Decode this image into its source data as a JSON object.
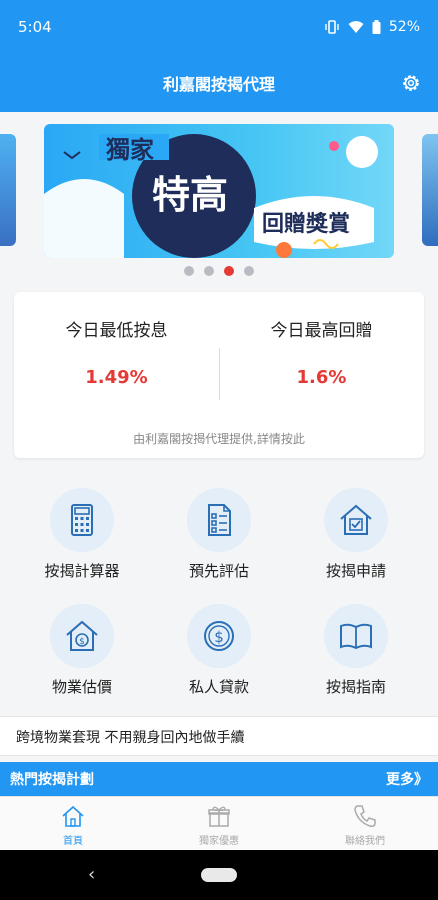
{
  "status": {
    "time": "5:04",
    "battery": "52%"
  },
  "appbar": {
    "title": "利嘉閣按揭代理"
  },
  "banner": {
    "line1": "獨家",
    "line2": "特高",
    "line3": "回贈獎賞"
  },
  "carousel": {
    "page_count": 4,
    "active_index": 2
  },
  "rates": {
    "lowest_label": "今日最低按息",
    "lowest_value": "1.49%",
    "highest_label": "今日最高回贈",
    "highest_value": "1.6%",
    "note": "由利嘉閣按揭代理提供,詳情按此"
  },
  "services": [
    {
      "label": "按揭計算器",
      "icon": "calculator-icon"
    },
    {
      "label": "預先評估",
      "icon": "checklist-icon"
    },
    {
      "label": "按揭申請",
      "icon": "house-check-icon"
    },
    {
      "label": "物業估價",
      "icon": "house-dollar-icon"
    },
    {
      "label": "私人貸款",
      "icon": "coin-dollar-icon"
    },
    {
      "label": "按揭指南",
      "icon": "book-icon"
    }
  ],
  "marquee": {
    "text": "跨境物業套現 不用親身回內地做手續"
  },
  "hot_plans": {
    "title": "熱門按揭計劃",
    "more": "更多》"
  },
  "tabs": [
    {
      "label": "首頁",
      "icon": "home-icon",
      "active": true
    },
    {
      "label": "獨家優惠",
      "icon": "gift-icon",
      "active": false
    },
    {
      "label": "聯絡我們",
      "icon": "phone-icon",
      "active": false
    }
  ],
  "colors": {
    "primary": "#2196f3",
    "accent_red": "#e53935",
    "icon_circle": "#e3eef8"
  }
}
